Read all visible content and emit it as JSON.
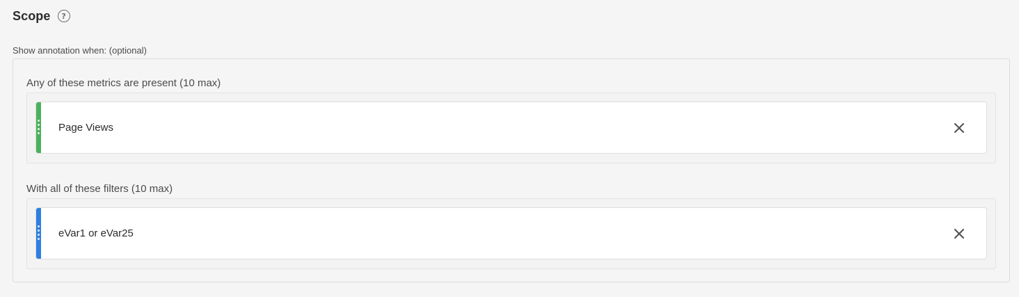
{
  "scope": {
    "title": "Scope",
    "help_glyph": "?",
    "help_icon": "question-circle-icon",
    "show_label": "Show annotation when: (optional)"
  },
  "metrics": {
    "label": "Any of these metrics are present (10 max)",
    "items": [
      {
        "text": "Page Views",
        "color": "#4bb15c",
        "remove_icon": "close-icon"
      }
    ]
  },
  "filters": {
    "label": "With all of these filters (10 max)",
    "items": [
      {
        "text": "eVar1 or eVar25",
        "color": "#2d7fe0",
        "remove_icon": "close-icon"
      }
    ]
  }
}
